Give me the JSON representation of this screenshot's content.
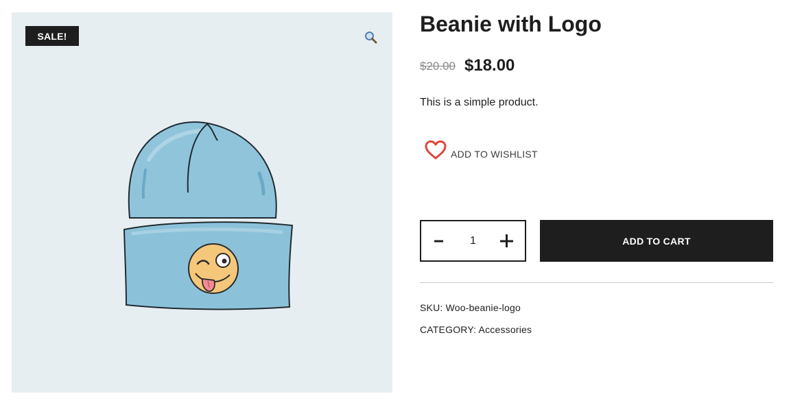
{
  "product": {
    "sale_badge": "SALE!",
    "title": "Beanie with Logo",
    "price_regular": "$20.00",
    "price_sale": "$18.00",
    "short_description": "This is a simple product."
  },
  "wishlist": {
    "label": "ADD TO WISHLIST",
    "icon": "heart-icon",
    "color": "#e0443a"
  },
  "cart": {
    "quantity": "1",
    "minus_label": "-",
    "plus_label": "+",
    "button_label": "ADD TO CART"
  },
  "meta": {
    "sku_label": "SKU:",
    "sku_value": "Woo-beanie-logo",
    "category_label": "CATEGORY:",
    "category_value": "Accessories"
  },
  "gallery": {
    "zoom_icon": "magnifier-icon",
    "background": "#e7eef2"
  }
}
